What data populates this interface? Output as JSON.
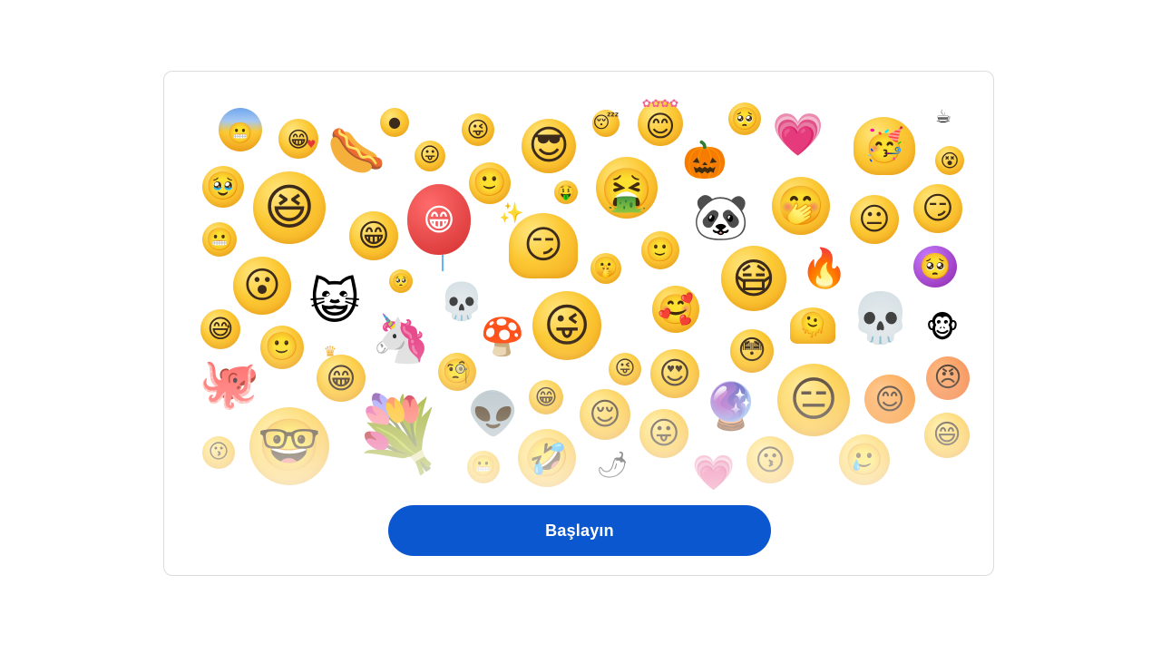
{
  "intro": {
    "start_button_label": "Başlayın"
  },
  "colors": {
    "button_bg": "#0b57d0",
    "button_text": "#ffffff",
    "card_border": "#dadce0",
    "emoji_yellow": "#fcc934"
  },
  "emoji_collage": [
    "cold-sweat-grin-face",
    "grimace-heart-face",
    "hotdog",
    "one-eye-face",
    "tongue-wink-face",
    "sunglasses-face",
    "sleepy-zzz-face",
    "flower-crown-face",
    "pleading-face",
    "pink-heart-face",
    "party-blob-face",
    "coffee-cup",
    "tongue-face",
    "pumpkin-face",
    "knocked-out-face",
    "tearful-grin-face",
    "big-smirk-face",
    "red-balloon-face",
    "smile-face",
    "money-face",
    "vomit-face",
    "panda-face",
    "hand-over-mouth-face",
    "neutral-face",
    "smirk-face",
    "grimace-face",
    "teeth-grin-face",
    "magic-wand-blob-face",
    "slight-smile-face",
    "hush-face",
    "wide-grin-face",
    "fire-face",
    "devil-pleading-face",
    "surprised-face",
    "cat-face",
    "small-pleading-face",
    "skull",
    "mask-face",
    "melting-face",
    "big-skull",
    "monkey-face",
    "sweat-face",
    "unicorn",
    "mushroom",
    "wink-laugh-face",
    "heart-eyes-face",
    "flushed-face",
    "smile-small-face",
    "octopus",
    "crown-face",
    "monocle-face",
    "alien",
    "grimace-small-face",
    "heart-eyes-smile-face",
    "crystal-ball",
    "expressionless-face",
    "orange-face",
    "angry-face",
    "kiss-face",
    "nerd-face",
    "bouquet",
    "grimace-tiny-face",
    "rofl-face",
    "relieved-face",
    "tongue-out-face",
    "chili-pepper",
    "pink-heart",
    "kissing-face",
    "crying-face",
    "laughing-face"
  ]
}
